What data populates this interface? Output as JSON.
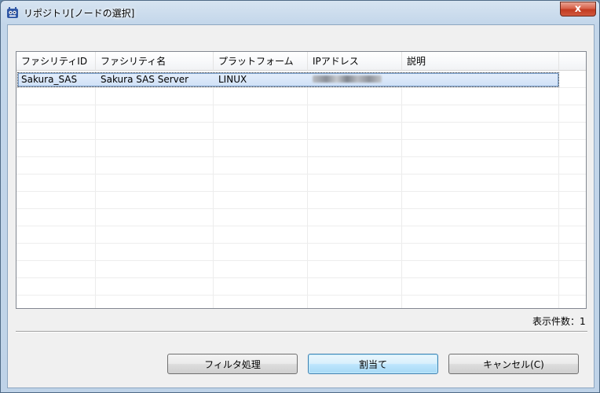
{
  "window": {
    "title": "リポジトリ[ノードの選択]",
    "close_label": "x"
  },
  "table": {
    "columns": [
      "ファシリティID",
      "ファシリティ名",
      "プラットフォーム",
      "IPアドレス",
      "説明"
    ],
    "rows": [
      {
        "facility_id": "Sakura_SAS",
        "facility_name": "Sakura SAS Server",
        "platform": "LINUX",
        "ip_address": "",
        "description": ""
      }
    ]
  },
  "status": {
    "count_label": "表示件数：1"
  },
  "buttons": {
    "filter": "フィルタ処理",
    "assign": "割当て",
    "cancel": "キャンセル(C)"
  },
  "colors": {
    "title_bar": "#c3d6ea",
    "close_button": "#c23b21",
    "selection": "#cfe0f6",
    "default_button_border": "#3c7fb1"
  }
}
